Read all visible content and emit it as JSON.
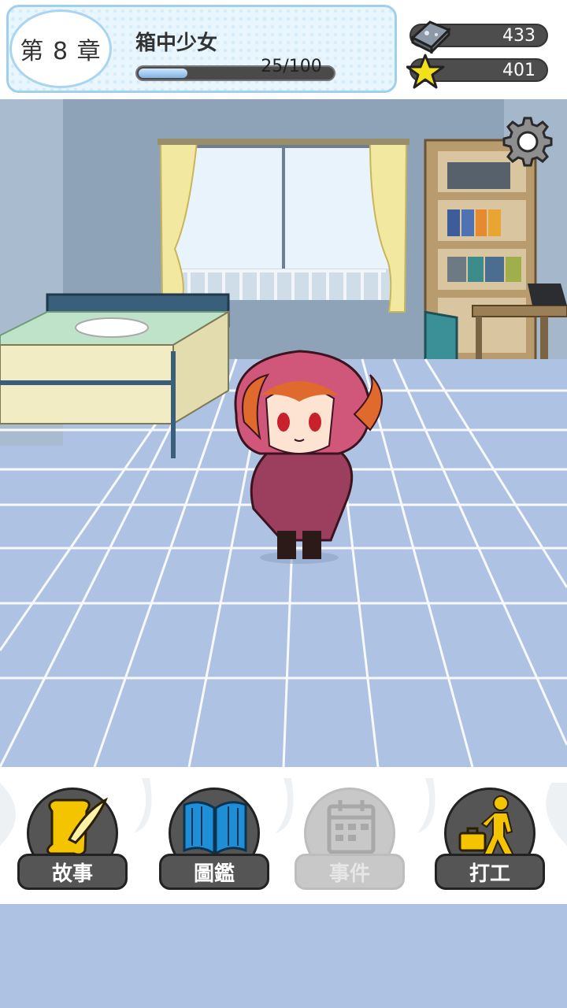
{
  "hud": {
    "chapter_label": "第 8 章",
    "chapter_title": "箱中少女",
    "progress_current": 25,
    "progress_max": 100,
    "progress_text": "25/100"
  },
  "resources": [
    {
      "icon": "tile-icon",
      "value": "433"
    },
    {
      "icon": "star-icon",
      "value": "401"
    }
  ],
  "menu": [
    {
      "label": "故事",
      "icon": "scroll-quill-icon",
      "enabled": true
    },
    {
      "label": "圖鑑",
      "icon": "open-book-icon",
      "enabled": true
    },
    {
      "label": "事件",
      "icon": "calendar-icon",
      "enabled": false
    },
    {
      "label": "打工",
      "icon": "walking-worker-icon",
      "enabled": true
    }
  ],
  "colors": {
    "panel_border": "#9fd0ee",
    "floor": "#aec3e3",
    "button_dark": "#555555",
    "button_disabled": "#c8c8c8",
    "accent_yellow": "#f5c400",
    "accent_blue": "#1e8fd6"
  }
}
